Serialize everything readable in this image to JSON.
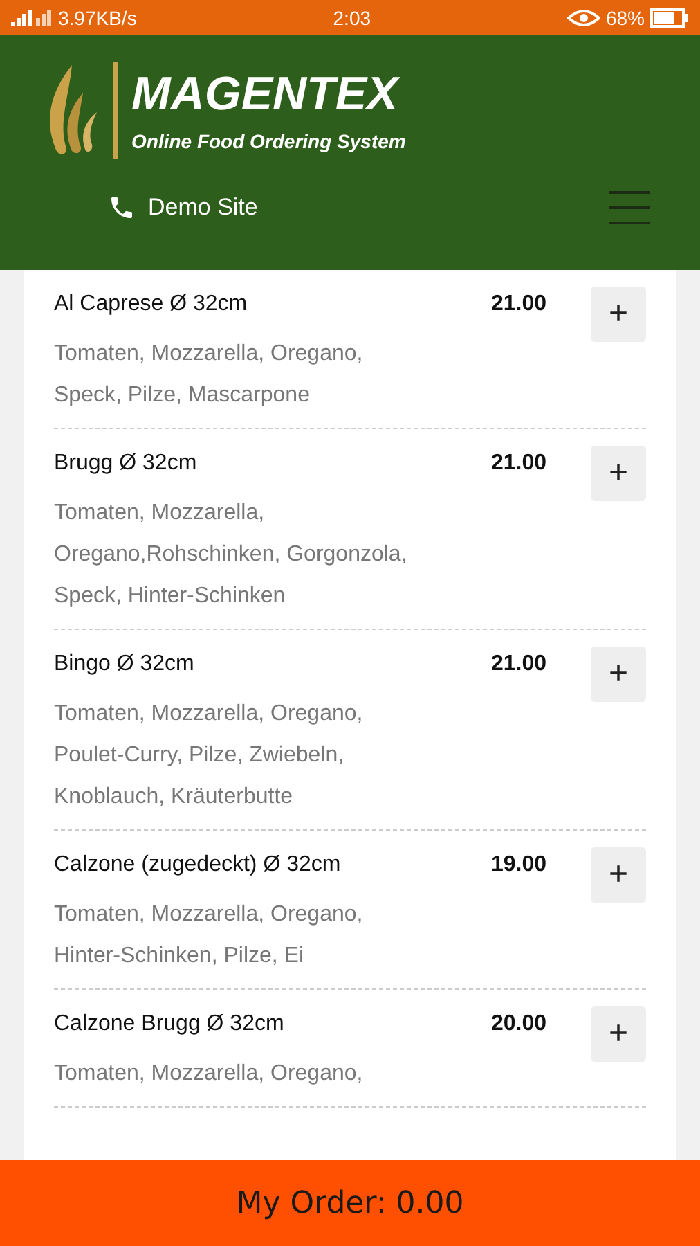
{
  "status_bar": {
    "signal": "3.97KB/s",
    "time": "2:03",
    "battery": "68%"
  },
  "header": {
    "brand": "MAGENTEX",
    "tagline": "Online Food Ordering System",
    "contact": "Demo Site"
  },
  "items": [
    {
      "name": "Al Caprese Ø 32cm",
      "price": "21.00",
      "add": "+",
      "description": [
        "Tomaten, Mozzarella, Oregano,",
        "Speck, Pilze, Mascarpone"
      ]
    },
    {
      "name": "Brugg Ø 32cm",
      "price": "21.00",
      "add": "+",
      "description": [
        "Tomaten, Mozzarella,",
        "Oregano,Rohschinken, Gorgonzola,",
        "Speck, Hinter-Schinken"
      ]
    },
    {
      "name": "Bingo Ø 32cm",
      "price": "21.00",
      "add": "+",
      "description": [
        "Tomaten, Mozzarella, Oregano,",
        "Poulet-Curry, Pilze, Zwiebeln,",
        "Knoblauch, Kräuterbutte"
      ]
    },
    {
      "name": "Calzone (zugedeckt) Ø 32cm",
      "price": "19.00",
      "add": "+",
      "description": [
        "Tomaten, Mozzarella, Oregano,",
        "Hinter-Schinken, Pilze, Ei"
      ]
    },
    {
      "name": "Calzone Brugg Ø 32cm",
      "price": "20.00",
      "add": "+",
      "description": [
        "Tomaten, Mozzarella, Oregano,"
      ]
    }
  ],
  "order_bar": {
    "label": "My Order: 0.00"
  }
}
